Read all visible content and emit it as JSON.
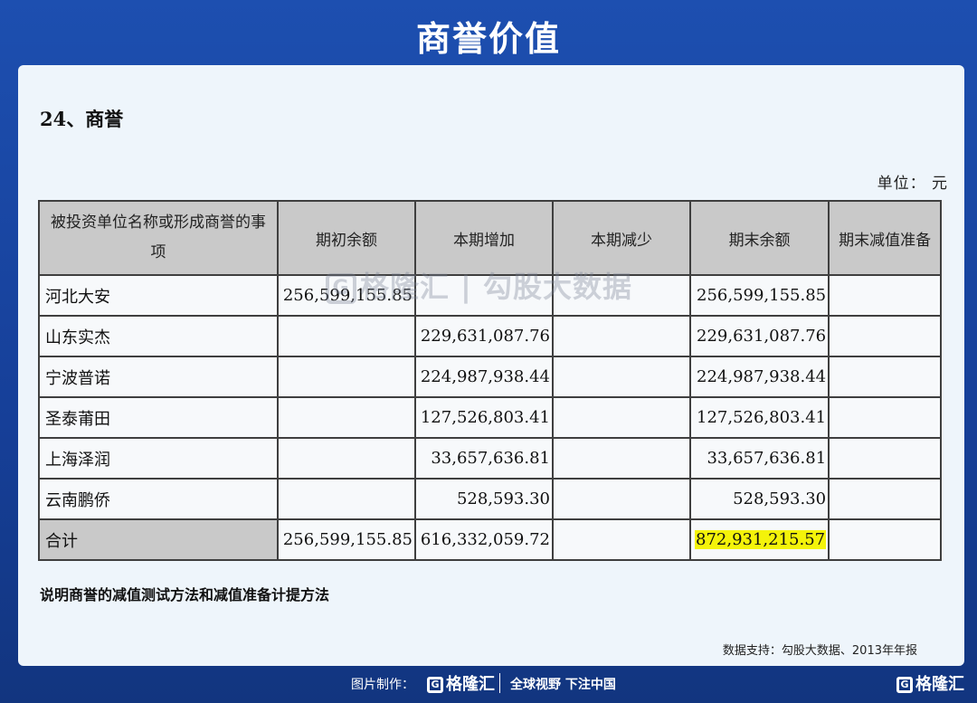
{
  "header": {
    "title": "商誉价值"
  },
  "document": {
    "section_heading": "24、商誉",
    "unit_label": "单位：  元",
    "table": {
      "columns": [
        "被投资单位名称或形成商誉的事项",
        "期初余额",
        "本期增加",
        "本期减少",
        "期末余额",
        "期末减值准备"
      ],
      "rows": [
        [
          "河北大安",
          "256,599,155.85",
          "",
          "",
          "256,599,155.85",
          ""
        ],
        [
          "山东实杰",
          "",
          "229,631,087.76",
          "",
          "229,631,087.76",
          ""
        ],
        [
          "宁波普诺",
          "",
          "224,987,938.44",
          "",
          "224,987,938.44",
          ""
        ],
        [
          "圣泰莆田",
          "",
          "127,526,803.41",
          "",
          "127,526,803.41",
          ""
        ],
        [
          "上海泽润",
          "",
          "33,657,636.81",
          "",
          "33,657,636.81",
          ""
        ],
        [
          "云南鹏侨",
          "",
          "528,593.30",
          "",
          "528,593.30",
          ""
        ]
      ],
      "total": [
        "合计",
        "256,599,155.85",
        "616,332,059.72",
        "",
        "872,931,215.57",
        ""
      ]
    },
    "note": "说明商誉的减值测试方法和减值准备计提方法",
    "source": "数据支持：勾股大数据、2013年年报"
  },
  "watermark": {
    "logo_letter": "G",
    "text": "格隆汇 | 勾股大数据"
  },
  "footer": {
    "made_by": "图片制作：",
    "brand": "格隆汇",
    "slogan": "全球视野 下注中国",
    "corner_brand": "格隆汇",
    "logo_letter": "G"
  },
  "colors": {
    "background": "#1d4fb0",
    "card": "#eef5fb",
    "header_cell": "#c9c9c9",
    "highlight": "#f4f30a"
  }
}
